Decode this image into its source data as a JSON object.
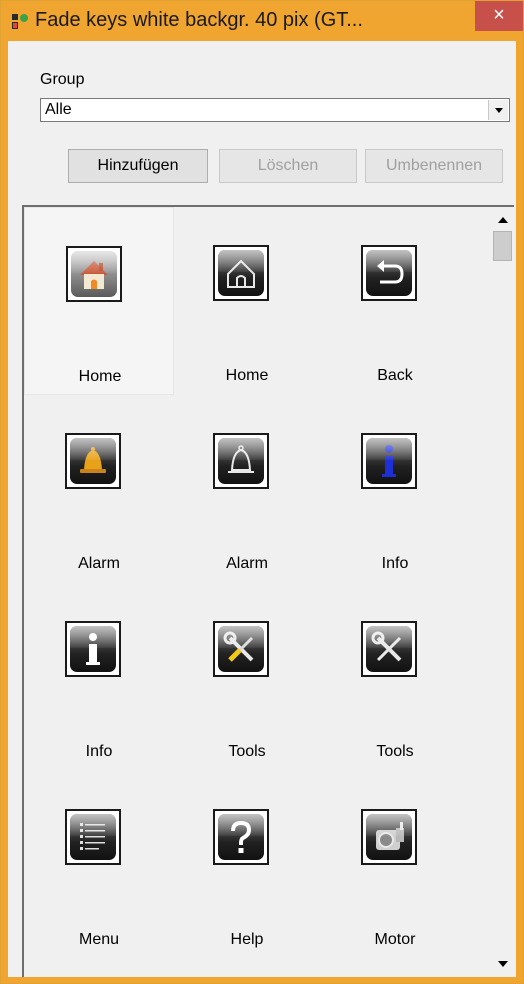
{
  "window": {
    "title": "Fade keys white backgr. 40 pix (GT...",
    "close_symbol": "×"
  },
  "group": {
    "label": "Group",
    "selected": "Alle",
    "buttons": {
      "add": "Hinzufügen",
      "delete": "Löschen",
      "rename": "Umbenennen"
    }
  },
  "tiles": [
    {
      "label": "Home",
      "icon": "home-color-icon"
    },
    {
      "label": "Home",
      "icon": "home-outline-icon"
    },
    {
      "label": "Back",
      "icon": "back-arrow-icon"
    },
    {
      "label": "Alarm",
      "icon": "bell-color-icon"
    },
    {
      "label": "Alarm",
      "icon": "bell-outline-icon"
    },
    {
      "label": "Info",
      "icon": "info-blue-icon"
    },
    {
      "label": "Info",
      "icon": "info-white-icon"
    },
    {
      "label": "Tools",
      "icon": "tools-color-icon"
    },
    {
      "label": "Tools",
      "icon": "tools-outline-icon"
    },
    {
      "label": "Menu",
      "icon": "menu-list-icon"
    },
    {
      "label": "Help",
      "icon": "help-question-icon"
    },
    {
      "label": "Motor",
      "icon": "motor-icon"
    }
  ],
  "colors": {
    "title_bar": "#f0a530",
    "close_button": "#c7504a"
  }
}
